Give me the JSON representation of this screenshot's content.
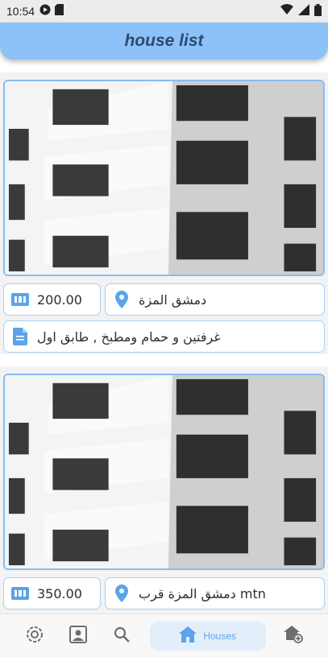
{
  "status_bar": {
    "time": "10:54"
  },
  "app_bar": {
    "title": "house list"
  },
  "houses": [
    {
      "price": "200.00",
      "location": "دمشق المزة",
      "description": "غرفتين و حمام ومطبخ , طابق اول"
    },
    {
      "price": "350.00",
      "location": "دمشق المزة قرب mtn"
    }
  ],
  "bottom_nav": {
    "items": [
      {
        "icon": "settings-icon"
      },
      {
        "icon": "profile-icon"
      },
      {
        "icon": "search-icon"
      },
      {
        "icon": "home-icon",
        "label": "Houses",
        "active": true
      },
      {
        "icon": "add-house-icon"
      }
    ]
  },
  "colors": {
    "accent": "#8cc2f8",
    "icon": "#5ba3ea",
    "title": "#2c4a6e",
    "pill_border": "#a9cff5"
  }
}
